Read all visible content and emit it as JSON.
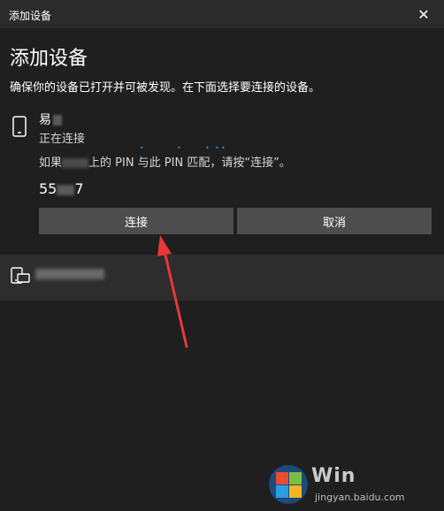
{
  "window": {
    "title": "添加设备",
    "close_glyph": "✕"
  },
  "heading": "添加设备",
  "subheading": "确保你的设备已打开并可被发现。在下面选择要连接的设备。",
  "device": {
    "icon": "phone-icon",
    "name_visible": "易",
    "status": "正在连接",
    "pin_prompt_before": "如果",
    "pin_prompt_after": "上的 PIN 与此 PIN 匹配，请按“连接”。",
    "pin_visible_start": "55",
    "pin_visible_end": "7"
  },
  "buttons": {
    "connect": "连接",
    "cancel": "取消"
  },
  "other_device": {
    "icon": "display-device-icon"
  },
  "watermark": {
    "text": "Win",
    "subtext": "jingyan.baidu.com"
  },
  "colors": {
    "background": "#1f1f1f",
    "button": "#4d4d4d",
    "arrow": "#e8373a",
    "accent": "#2a8ad4"
  }
}
